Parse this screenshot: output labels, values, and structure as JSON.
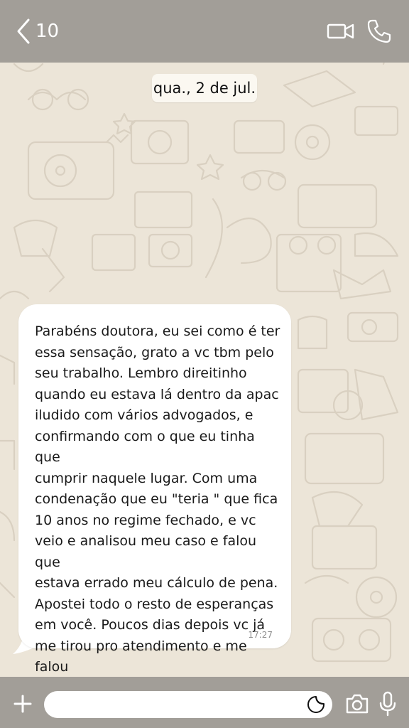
{
  "header": {
    "back_count": "10",
    "back_icon": "chevron-left-icon",
    "video_icon": "video-call-icon",
    "phone_icon": "phone-icon"
  },
  "chat": {
    "date_label": "qua., 2 de jul.",
    "messages": [
      {
        "text": "Parabéns doutora, eu sei como é ter\nessa sensação, grato a vc tbm pelo\nseu trabalho. Lembro direitinho\nquando eu estava lá dentro da apac\niludido com vários advogados, e\nconfirmando com o que eu tinha que\ncumprir naquele lugar. Com uma\ncondenação que eu \"teria \" que fica\n10 anos no regime fechado, e vc\nveio e analisou meu caso e falou que\nestava errado meu cálculo de pena.\nApostei todo o resto de esperanças\nem você. Poucos dias depois vc já\nme tirou pro atendimento e me falou\nque meu alvará cantou",
        "time": "17:27",
        "direction": "incoming"
      }
    ]
  },
  "footer": {
    "input_value": "",
    "icons": [
      "plus-icon",
      "sticker-icon",
      "camera-icon",
      "microphone-icon"
    ]
  },
  "colors": {
    "bar": "#a29e98",
    "wallpaper": "#ece5d8",
    "bubble": "#ffffff"
  }
}
